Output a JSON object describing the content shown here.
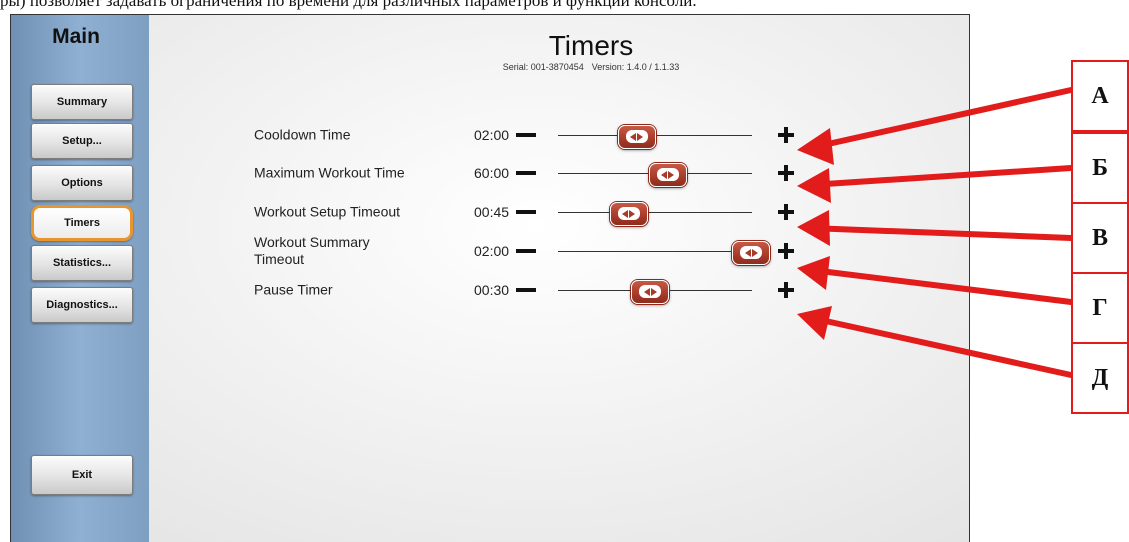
{
  "caption": "ры) позволяет задавать ограничения по времени для различных параметров и функций консоли.",
  "sidebar": {
    "title": "Main",
    "items": [
      {
        "label": "Summary"
      },
      {
        "label": "Setup..."
      },
      {
        "label": "Options"
      },
      {
        "label": "Timers",
        "active": true
      },
      {
        "label": "Statistics..."
      },
      {
        "label": "Diagnostics..."
      }
    ],
    "exit_label": "Exit"
  },
  "header": {
    "title": "Timers",
    "serial": "Serial: 001-3870454",
    "version": "Version: 1.4.0 / 1.1.33"
  },
  "timers": [
    {
      "label": "Cooldown Time",
      "value": "02:00",
      "slider_fraction": 0.4
    },
    {
      "label": "Maximum Workout Time",
      "value": "60:00",
      "slider_fraction": 0.56
    },
    {
      "label": "Workout Setup Timeout",
      "value": "00:45",
      "slider_fraction": 0.36
    },
    {
      "label": "Workout Summary Timeout",
      "value": "02:00",
      "slider_fraction": 0.99
    },
    {
      "label": "Pause Timer",
      "value": "00:30",
      "slider_fraction": 0.47
    }
  ],
  "callouts": [
    {
      "letter": "А"
    },
    {
      "letter": "Б"
    },
    {
      "letter": "В"
    },
    {
      "letter": "Г"
    },
    {
      "letter": "Д"
    }
  ],
  "colors": {
    "sidebar": "#8fb0d2",
    "active_border": "#e8952f",
    "slider_thumb": "#a83a28",
    "callout_red": "#e21b1b"
  }
}
